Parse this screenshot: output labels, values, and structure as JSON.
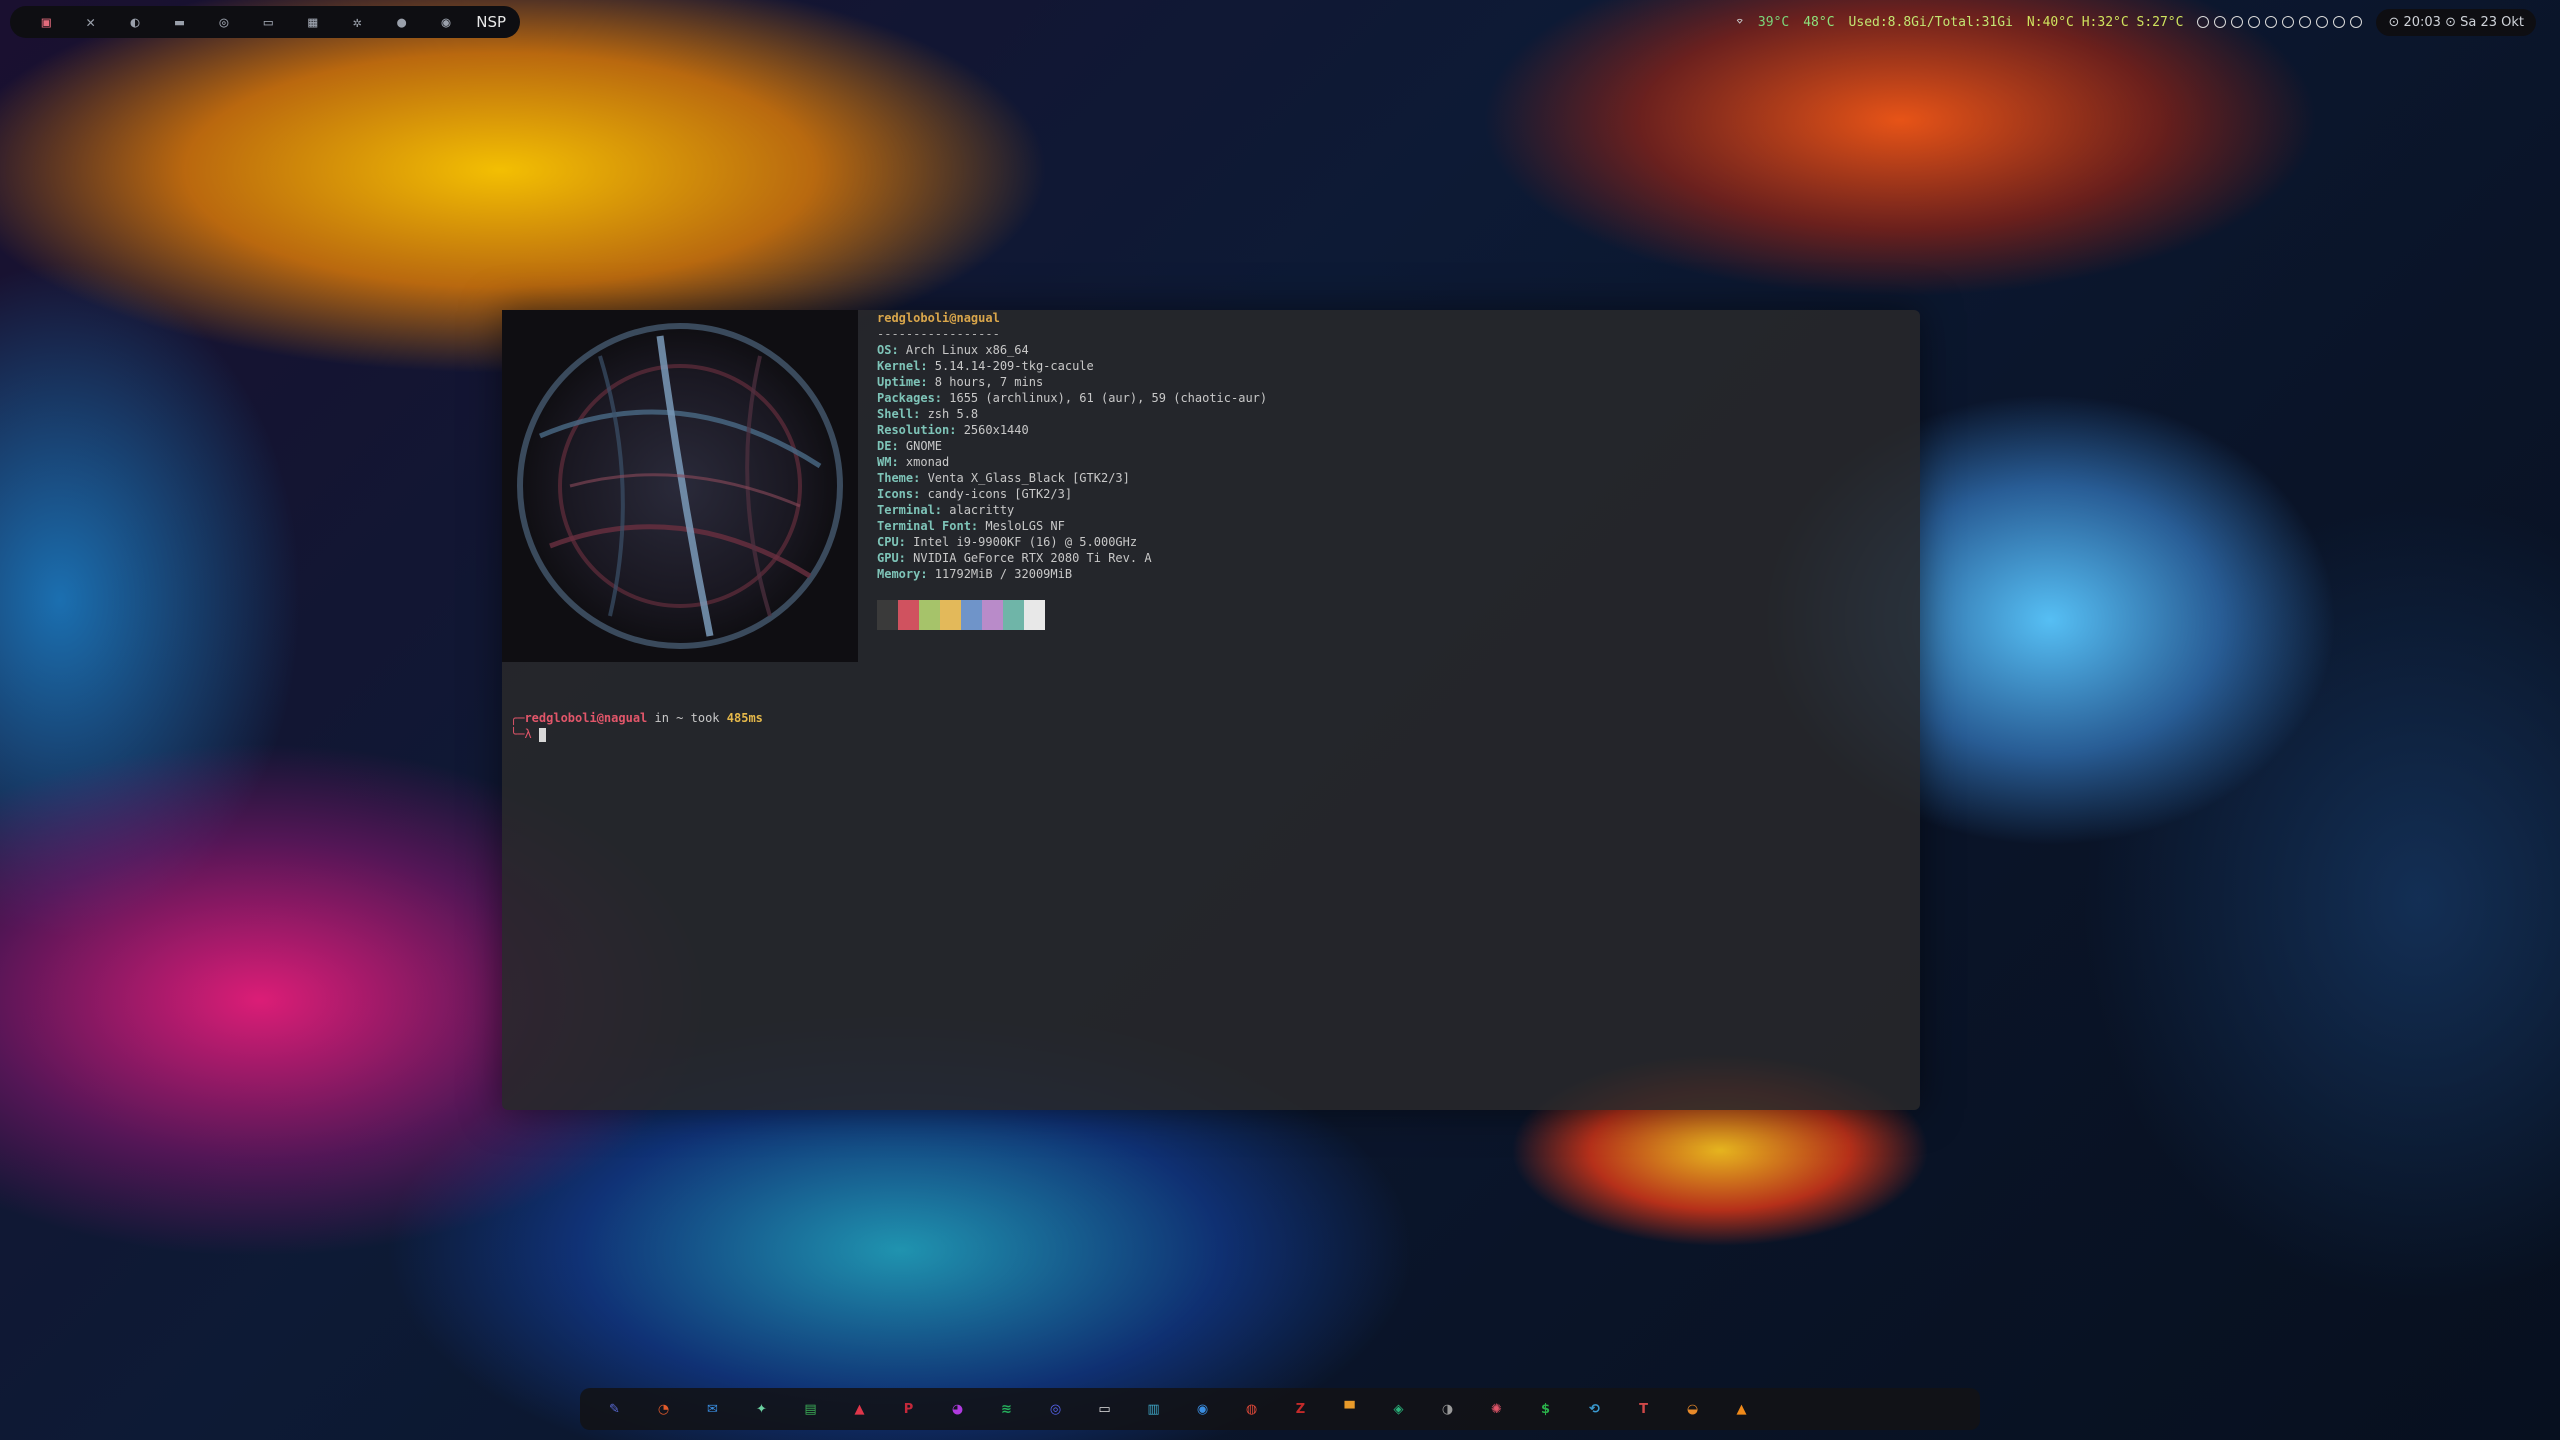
{
  "topbar": {
    "workspaces": [
      {
        "icon": "square-icon",
        "glyph": "▣"
      },
      {
        "icon": "close-icon",
        "glyph": "✕"
      },
      {
        "icon": "moon-icon",
        "glyph": "◐"
      },
      {
        "icon": "folder-icon",
        "glyph": "▬"
      },
      {
        "icon": "gamepad-icon",
        "glyph": "◎"
      },
      {
        "icon": "chat-icon",
        "glyph": "▭"
      },
      {
        "icon": "grid-icon",
        "glyph": "▦"
      },
      {
        "icon": "bug-icon",
        "glyph": "✲"
      },
      {
        "icon": "circle-icon",
        "glyph": "●"
      },
      {
        "icon": "spotify-icon",
        "glyph": "◉"
      }
    ],
    "scratchpad_label": "NSP",
    "status": {
      "cpu_temp": "39°C",
      "gpu_temp": "48°C",
      "memory": "Used:8.8Gi/Total:31Gi",
      "temps": "N:40°C H:32°C S:27°C"
    },
    "clock": "⊙ 20:03 ⊙ Sa 23 Okt"
  },
  "terminal": {
    "user_host": "redgloboli@nagual",
    "separator": "-----------------",
    "info": [
      {
        "key": "OS",
        "value": "Arch Linux x86_64"
      },
      {
        "key": "Kernel",
        "value": "5.14.14-209-tkg-cacule"
      },
      {
        "key": "Uptime",
        "value": "8 hours, 7 mins"
      },
      {
        "key": "Packages",
        "value": "1655 (archlinux), 61 (aur), 59 (chaotic-aur)"
      },
      {
        "key": "Shell",
        "value": "zsh 5.8"
      },
      {
        "key": "Resolution",
        "value": "2560x1440"
      },
      {
        "key": "DE",
        "value": "GNOME"
      },
      {
        "key": "WM",
        "value": "xmonad"
      },
      {
        "key": "Theme",
        "value": "Venta X_Glass_Black [GTK2/3]"
      },
      {
        "key": "Icons",
        "value": "candy-icons [GTK2/3]"
      },
      {
        "key": "Terminal",
        "value": "alacritty"
      },
      {
        "key": "Terminal Font",
        "value": "MesloLGS NF"
      },
      {
        "key": "CPU",
        "value": "Intel i9-9900KF (16) @ 5.000GHz"
      },
      {
        "key": "GPU",
        "value": "NVIDIA GeForce RTX 2080 Ti Rev. A"
      },
      {
        "key": "Memory",
        "value": "11792MiB / 32009MiB"
      }
    ],
    "palette": [
      "#3a3a3a",
      "#d0525f",
      "#a6c36a",
      "#e3b95a",
      "#6f94c9",
      "#b98bc9",
      "#6fb5a8",
      "#e8e8e8"
    ],
    "prompt": {
      "user_host": "redgloboli@nagual",
      "in_text": " in ~ took ",
      "duration": "485ms"
    }
  },
  "dock": {
    "items": [
      {
        "name": "editor-icon",
        "glyph": "✎",
        "color": "#5b6bd6"
      },
      {
        "name": "timeshift-icon",
        "glyph": "◔",
        "color": "#e25a2a"
      },
      {
        "name": "mail-icon",
        "glyph": "✉",
        "color": "#3a8de0"
      },
      {
        "name": "inkscape-icon",
        "glyph": "✦",
        "color": "#6ad0a0"
      },
      {
        "name": "document-icon",
        "glyph": "▤",
        "color": "#3cae57"
      },
      {
        "name": "arch-icon",
        "glyph": "▲",
        "color": "#e0364a"
      },
      {
        "name": "pdf-icon",
        "glyph": "P",
        "color": "#c4283a"
      },
      {
        "name": "firefox-icon",
        "glyph": "◕",
        "color": "#b03adf"
      },
      {
        "name": "spotify-icon",
        "glyph": "≋",
        "color": "#25b05c"
      },
      {
        "name": "discord-icon",
        "glyph": "◎",
        "color": "#5865f2"
      },
      {
        "name": "files-icon",
        "glyph": "▭",
        "color": "#e0e0e0"
      },
      {
        "name": "notes-icon",
        "glyph": "▥",
        "color": "#3fa8c8"
      },
      {
        "name": "chromium-icon",
        "glyph": "◉",
        "color": "#3a8de0"
      },
      {
        "name": "chrome-icon",
        "glyph": "◍",
        "color": "#e04838"
      },
      {
        "name": "filezilla-icon",
        "glyph": "Z",
        "color": "#c42a2a"
      },
      {
        "name": "paint-icon",
        "glyph": "▀",
        "color": "#e89a2a"
      },
      {
        "name": "shield-icon",
        "glyph": "◈",
        "color": "#2ab27a"
      },
      {
        "name": "github-icon",
        "glyph": "◑",
        "color": "#9a9a9a"
      },
      {
        "name": "palette-icon",
        "glyph": "✺",
        "color": "#e2566a"
      },
      {
        "name": "dollar-icon",
        "glyph": "$",
        "color": "#2ab04a"
      },
      {
        "name": "sync-icon",
        "glyph": "⟲",
        "color": "#3a9ad0"
      },
      {
        "name": "text-icon",
        "glyph": "T",
        "color": "#d04848"
      },
      {
        "name": "blender-icon",
        "glyph": "◒",
        "color": "#e88a2a"
      },
      {
        "name": "vlc-icon",
        "glyph": "▲",
        "color": "#f08a1a"
      }
    ]
  }
}
